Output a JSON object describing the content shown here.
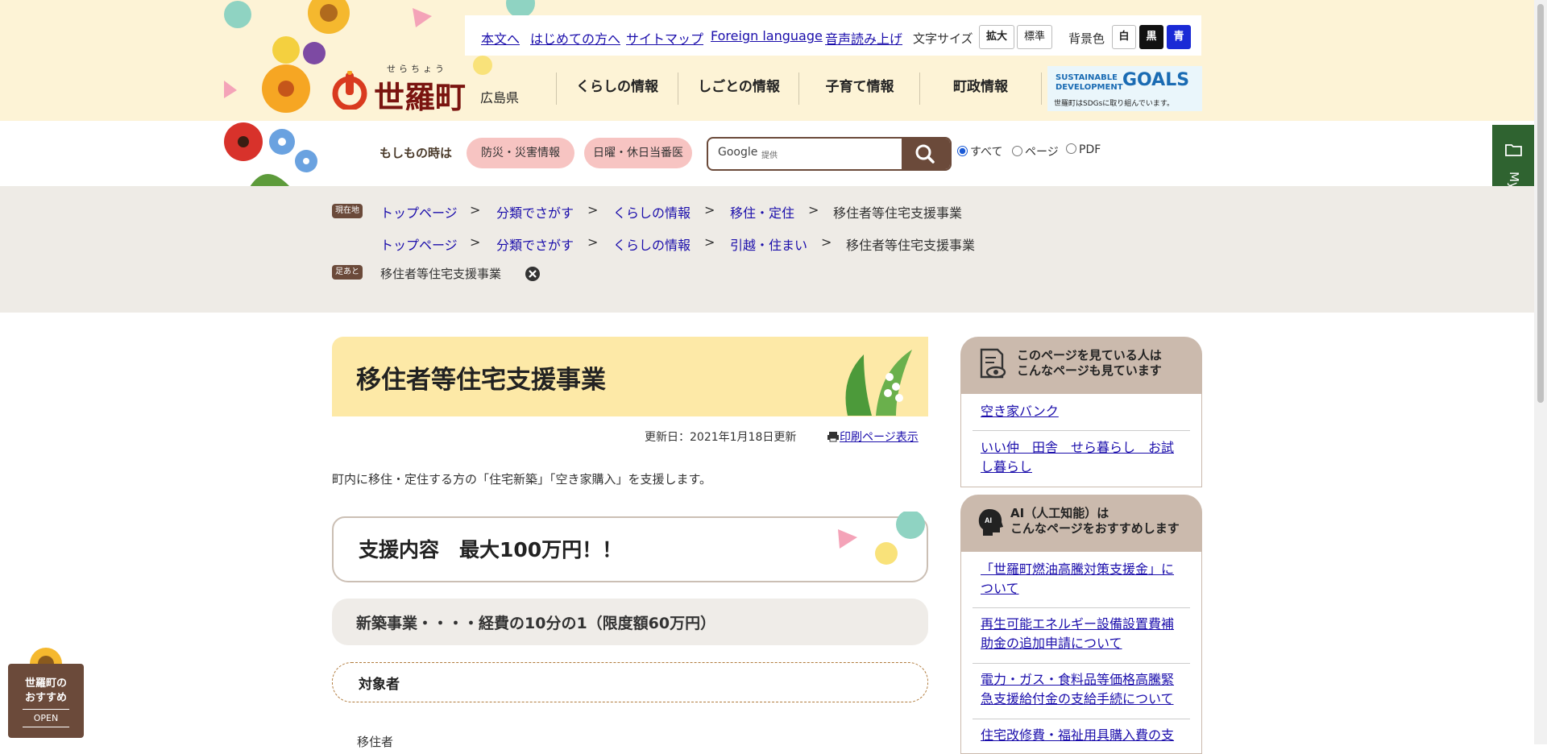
{
  "util_links": [
    "本文へ",
    "はじめての方へ",
    "サイトマップ",
    "Foreign language",
    "音声読み上げ"
  ],
  "text_size": {
    "label": "文字サイズ",
    "large": "拡大",
    "normal": "標準"
  },
  "bg_color": {
    "label": "背景色",
    "white": "白",
    "black": "黒",
    "blue": "青"
  },
  "logo": {
    "name": "世羅町",
    "ruby": "せらちょう",
    "pref": "広島県"
  },
  "nav": [
    "くらしの情報",
    "しごとの情報",
    "子育て情報",
    "町政情報"
  ],
  "sdgs": {
    "line1": "SUSTAINABLE",
    "line2": "DEVELOPMENT",
    "goals": "GOALS",
    "caption": "世羅町はSDGsに取り組んでいます。"
  },
  "emergency": {
    "label": "もしもの時は",
    "disaster": "防災・災害情報",
    "holiday": "日曜・休日当番医"
  },
  "search": {
    "brand": "Google",
    "provided": "提供"
  },
  "search_scope": {
    "all": "すべて",
    "page": "ページ",
    "pdf": "PDF"
  },
  "breadcrumbs": {
    "current_badge": "現在地",
    "trail1": [
      "トップページ",
      "分類でさがす",
      "くらしの情報",
      "移住・定住",
      "移住者等住宅支援事業"
    ],
    "trail2": [
      "トップページ",
      "分類でさがす",
      "くらしの情報",
      "引越・住まい",
      "移住者等住宅支援事業"
    ],
    "history_badge": "足あと",
    "history_item": "移住者等住宅支援事業",
    "sep": ">"
  },
  "page": {
    "title": "移住者等住宅支援事業",
    "updated": "更新日：2021年1月18日更新",
    "print": "印刷ページ表示",
    "intro": "町内に移住・定住する方の「住宅新築」「空き家購入」を支援します。",
    "h2": "支援内容　最大100万円！！",
    "h3": "新築事業・・・・経費の10分の1（限度額60万円）",
    "h4": "対象者",
    "body_start": "移住者"
  },
  "sidebar": {
    "viewers": {
      "title_line1": "このページを見ている人は",
      "title_line2": "こんなページも見ています",
      "links": [
        "空き家バンク",
        "いい仲　田舎　せら暮らし　お試し暮らし"
      ]
    },
    "ai": {
      "title_line1": "AI（人工知能）は",
      "title_line2": "こんなページをおすすめします",
      "links": [
        "「世羅町燃油高騰対策支援金」について",
        "再生可能エネルギー設備設置費補助金の追加申請について",
        "電力・ガス・食料品等価格高騰緊急支援給付金の支給手続について",
        "住宅改修費・福祉用具購入費の支"
      ]
    }
  },
  "mypage": {
    "label": "Myページへ保存"
  },
  "osusume": {
    "line1": "世羅町の",
    "line2": "おすすめ",
    "open": "OPEN"
  },
  "colors": {
    "header_bg": "#fdf3d6",
    "brown": "#6b4a3a",
    "pill": "#f7c4c2",
    "green": "#2f6330",
    "title_bg": "#fde9a7"
  }
}
